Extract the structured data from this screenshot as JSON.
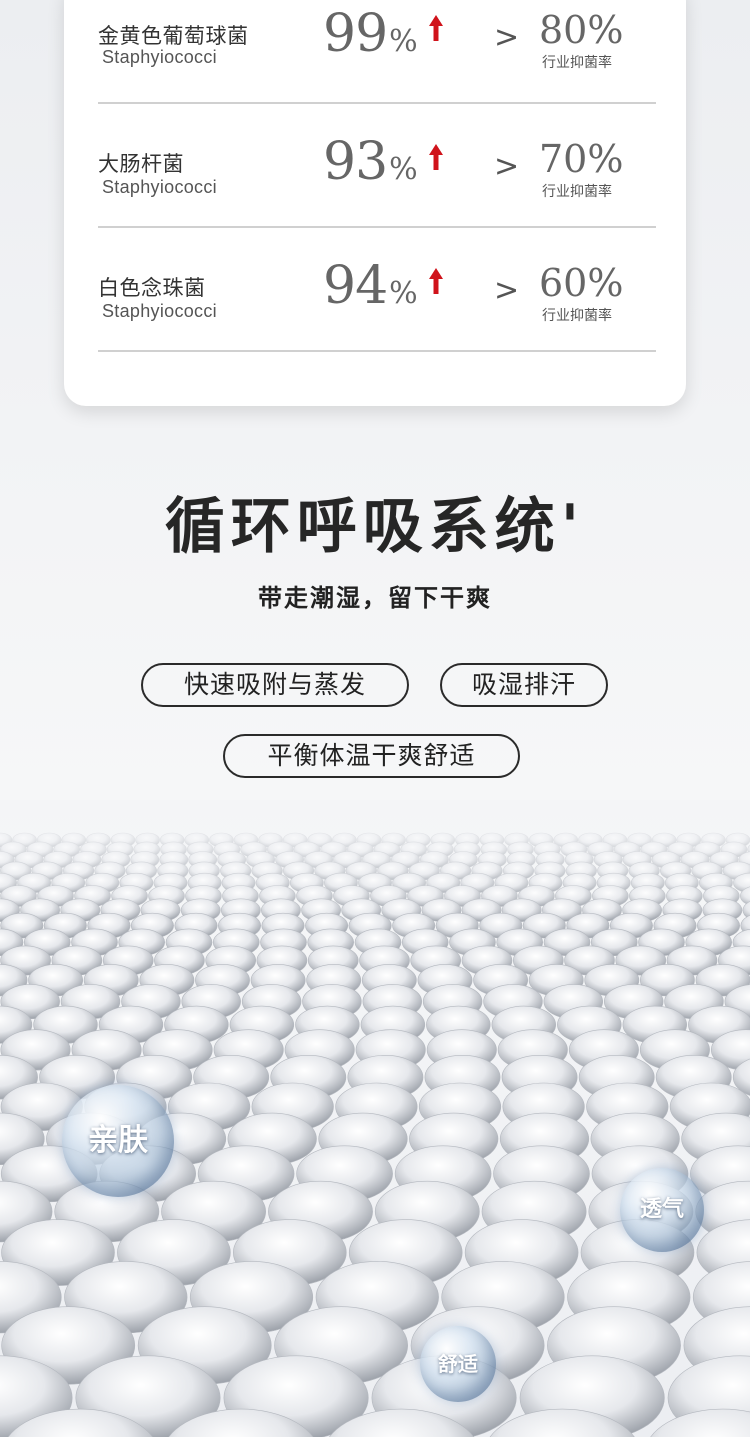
{
  "stats": {
    "rows": [
      {
        "name_cn": "金黄色葡萄球菌",
        "name_en": "Staphyiococci",
        "rate": "99",
        "unit": "%",
        "compare": ">",
        "industry_rate": "80%",
        "industry_label": "行业抑菌率"
      },
      {
        "name_cn": "大肠杆菌",
        "name_en": "Staphyiococci",
        "rate": "93",
        "unit": "%",
        "compare": ">",
        "industry_rate": "70%",
        "industry_label": "行业抑菌率"
      },
      {
        "name_cn": "白色念珠菌",
        "name_en": "Staphyiococci",
        "rate": "94",
        "unit": "%",
        "compare": ">",
        "industry_rate": "60%",
        "industry_label": "行业抑菌率"
      }
    ],
    "arrow_icon": "up-arrow-icon",
    "arrow_color": "#d0131b"
  },
  "heading": {
    "title": "循环呼吸系统'",
    "subtitle": "带走潮湿，留下干爽"
  },
  "features": [
    "快速吸附与蒸发",
    "吸湿排汗",
    "平衡体温干爽舒适"
  ],
  "bubbles": [
    "亲肤",
    "透气",
    "舒适"
  ]
}
